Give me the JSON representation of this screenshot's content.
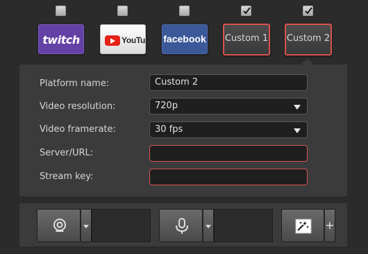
{
  "platforms": [
    {
      "id": "twitch",
      "logo_text": "twitch",
      "checked": false
    },
    {
      "id": "youtube",
      "logo_text": "YouTube",
      "checked": false
    },
    {
      "id": "facebook",
      "logo_text": "facebook",
      "checked": false
    },
    {
      "id": "custom1",
      "label": "Custom 1",
      "checked": true
    },
    {
      "id": "custom2",
      "label": "Custom 2",
      "checked": true
    }
  ],
  "settings": {
    "platform_name_label": "Platform name:",
    "platform_name_value": "Custom 2",
    "video_resolution_label": "Video resolution:",
    "video_resolution_value": "720p",
    "video_framerate_label": "Video framerate:",
    "video_framerate_value": "30 fps",
    "server_url_label": "Server/URL:",
    "server_url_value": "",
    "stream_key_label": "Stream key:",
    "stream_key_value": ""
  },
  "toolbar": {
    "add_glyph": "+",
    "icons": [
      "webcam-icon",
      "microphone-icon",
      "effects-icon"
    ]
  },
  "colors": {
    "error_border": "#d9534f",
    "twitch": "#6441a5",
    "facebook": "#3b5998",
    "youtube_red": "#e62117"
  }
}
